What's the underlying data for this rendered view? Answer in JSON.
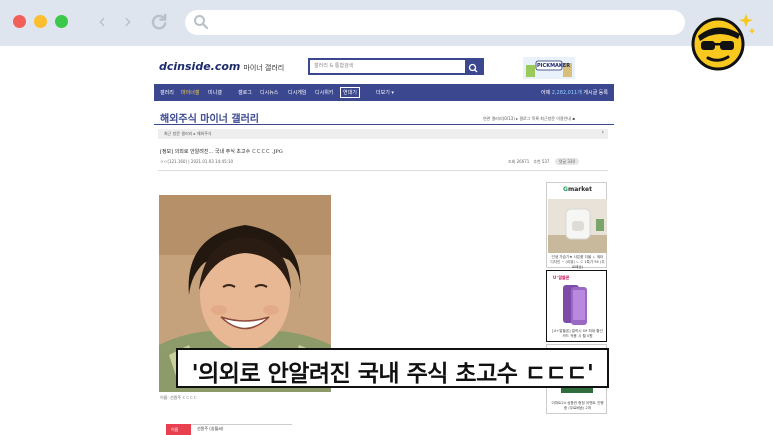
{
  "site": {
    "logo": "dcinside.com",
    "logo_sub": "마이너 갤러리",
    "search_placeholder": "갤러리 & 통합검색",
    "banner_label": "PICKMAKER"
  },
  "navbar": {
    "items": [
      "갤러리",
      "마이너갤",
      "미니갤",
      "갤로그",
      "디시뉴스",
      "디시게임",
      "디시위키",
      "이벤트",
      "더보기 ▾"
    ],
    "highlight": "연대기",
    "right_prefix": "어제",
    "right_count": "2,282,011개",
    "right_suffix": "게시글 등록"
  },
  "gallery": {
    "title": "해외주식 마이너 갤러리",
    "links": "연관 갤러리(0/13) ▸   갤로그 목록   최근방문   이용안내   ▪",
    "breadcrumb": "최근 방문 갤러리  ▸  해외주식"
  },
  "post": {
    "title": "[정보] 의외로 안알려진... 국내 주식 초고수 ㄷㄷㄷㄷ .JPG",
    "meta": "ㅇㅇ(121.160)   |   2021.01.03 14:45:10",
    "views": "조회 26671",
    "recommend": "추천 537",
    "comments": "댓글 330",
    "caption": "이름: 선원주 ㄷㄷㄷㄷ"
  },
  "ads": {
    "gmarket_logo_g": "G",
    "gmarket_logo_rest": "market",
    "gmarket_text": "인생 가습기★ 사은품 더블 ㄴ 워터 디자인 ~ (리뷰) ㄴ C 1특가 95 (무료배송)",
    "lg_logo": "U⁺알뜰폰",
    "lg_text": "[U+알뜰폰] 갤럭시 S9 최대 할인 카드 적용 시 월 0원",
    "bottom_text": "이마트24 상품권 증정 이벤트 진행 중 (무료배송) 2개"
  },
  "subtitle": "'의외로 안알려진 국내 주식 초고수 ㄷㄷㄷ'",
  "profile": {
    "label": "이름",
    "value": "선원주 (송월씨)"
  },
  "colors": {
    "brand_navy": "#3b4890",
    "highlight_yellow": "#f8d24a",
    "traffic_red": "#f25f58",
    "traffic_yellow": "#fbbe2e",
    "traffic_green": "#3cc84a"
  },
  "icons": [
    "back-arrow-icon",
    "forward-arrow-icon",
    "reload-icon",
    "search-icon",
    "mascot-icon"
  ]
}
